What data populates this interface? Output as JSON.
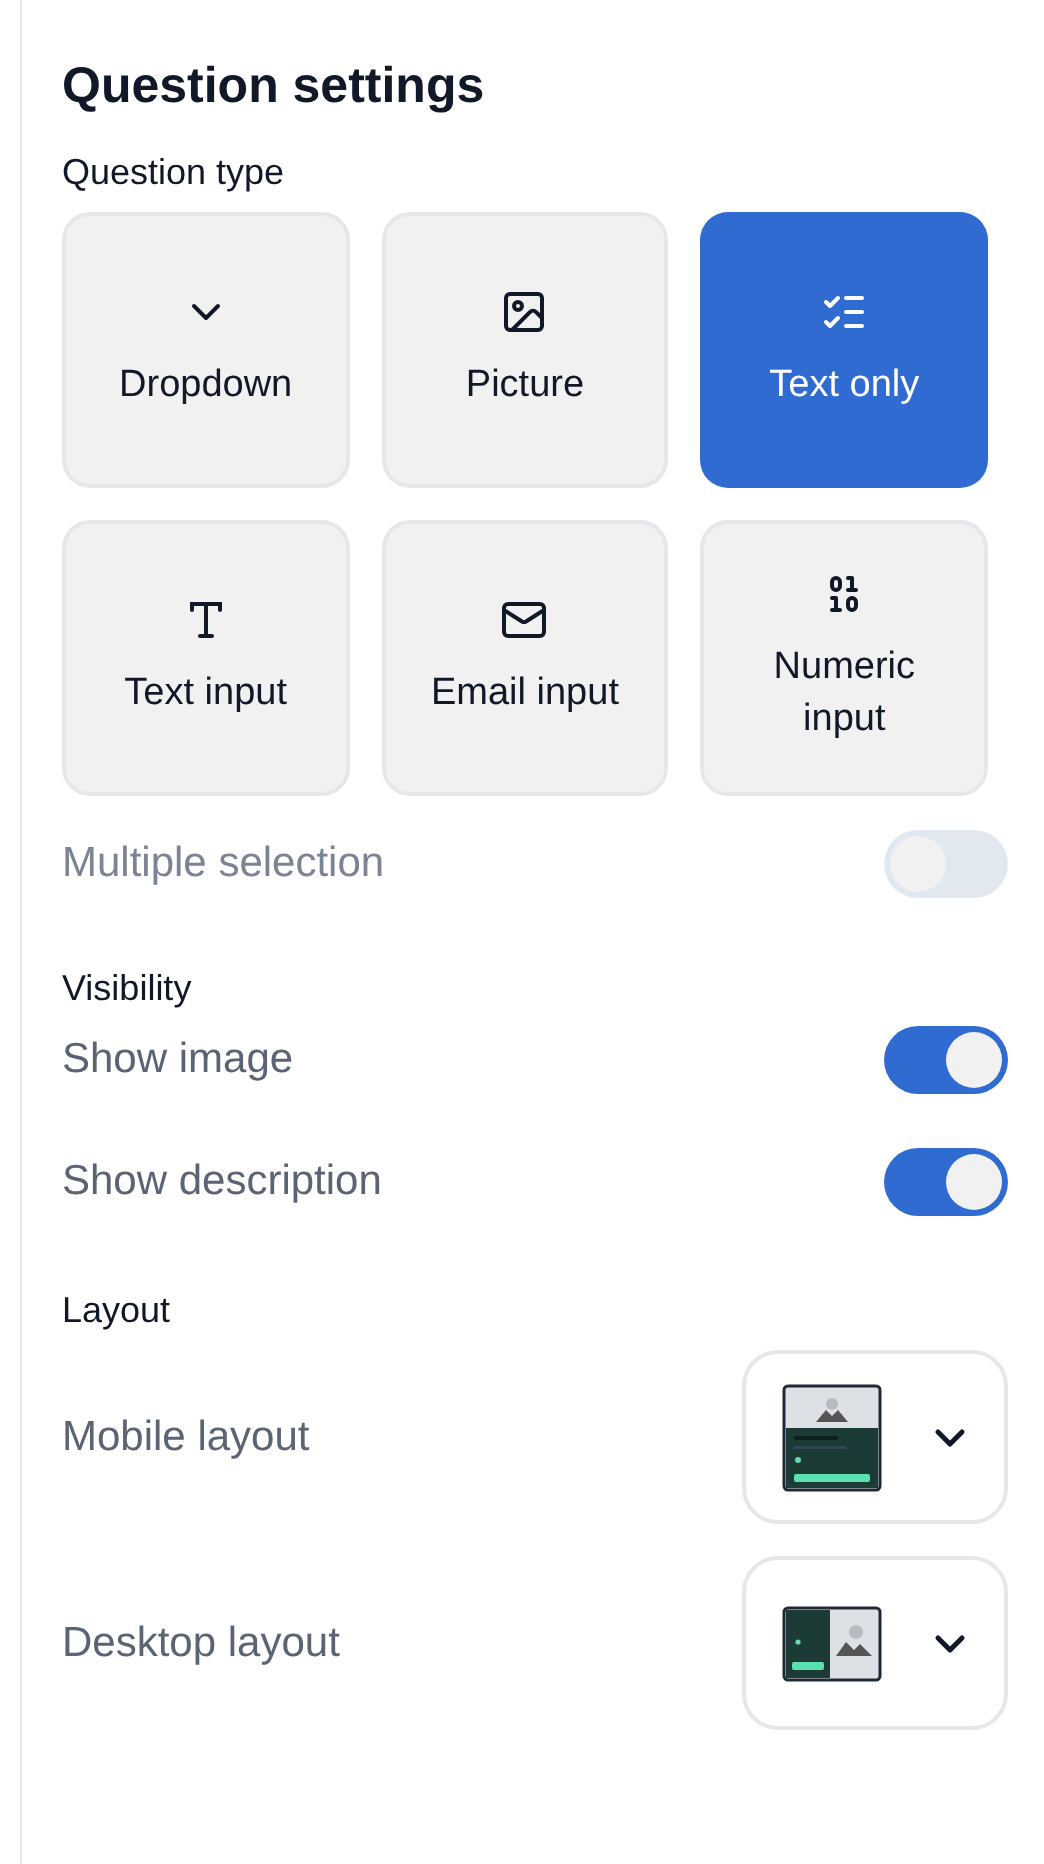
{
  "title": "Question settings",
  "question_type": {
    "label": "Question type",
    "options": [
      {
        "kind": "dropdown",
        "label": "Dropdown",
        "selected": false
      },
      {
        "kind": "picture",
        "label": "Picture",
        "selected": false
      },
      {
        "kind": "text_only",
        "label": "Text only",
        "selected": true
      },
      {
        "kind": "text_input",
        "label": "Text input",
        "selected": false
      },
      {
        "kind": "email_input",
        "label": "Email input",
        "selected": false
      },
      {
        "kind": "numeric_input",
        "label": "Numeric input",
        "selected": false
      }
    ]
  },
  "multiple_selection": {
    "label": "Multiple selection",
    "on": false,
    "disabled": true
  },
  "visibility": {
    "label": "Visibility",
    "items": [
      {
        "label": "Show image",
        "on": true
      },
      {
        "label": "Show description",
        "on": true
      }
    ]
  },
  "layout": {
    "label": "Layout",
    "items": [
      {
        "kind": "mobile",
        "label": "Mobile layout"
      },
      {
        "kind": "desktop",
        "label": "Desktop layout"
      }
    ]
  }
}
